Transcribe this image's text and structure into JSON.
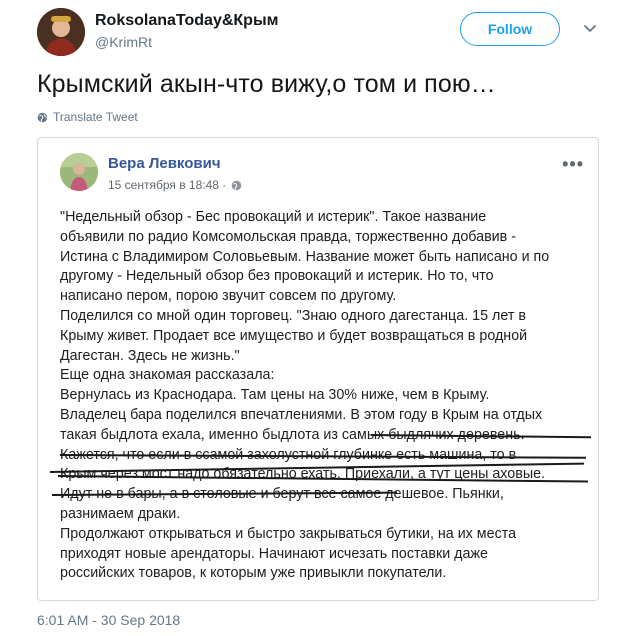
{
  "author": {
    "name": "RoksolanaToday&Крым",
    "handle": "@KrimRt"
  },
  "follow_label": "Follow",
  "tweet_text": "Крымский акын-что вижу,о том и пою…",
  "translate_label": "Translate Tweet",
  "embedded_post": {
    "author_name": "Вера Левкович",
    "date": "15 сентября в 18:48 ·",
    "more_label": "•••",
    "lines": [
      "\"Недельный обзор - Бес провокаций и истерик\". Такое название",
      "объявили по радио Комсомольская правда, торжественно добавив -",
      "Истина с Владимиром Соловьевым. Название может быть написано и по",
      "другому - Недельный обзор без провокаций и истерик. Но то, что",
      "написано пером, порою звучит совсем по другому.",
      "Поделился со мной один торговец. \"Знаю одного дагестанца. 15 лет в",
      "Крыму живет. Продает все имущество и будет возвращаться в родной",
      "Дагестан. Здесь не жизнь.\"",
      "Еще одна знакомая рассказала:",
      "Вернулась из Краснодара. Там цены на 30% ниже, чем в Крыму.",
      "Владелец бара поделился впечатлениями. В этом году в Крым на отдых",
      "такая быдлота ехала, именно быдлота из самых быдлячих деревень.",
      "Кажется, что если в ссамой захолустной глубинке есть машина, то в",
      "Крым через мост надо обязательно ехать. Приехали, а тут цены аховые.",
      "Идут не в бары, а в столовые и берут все самое дешевое. Пьянки,",
      "разнимаем драки.",
      "Продолжают открываться и быстро закрываться бутики, на их места",
      "приходят новые арендаторы. Начинают исчезать поставки даже",
      "российских товаров, к которым уже привыкли покупатели."
    ]
  },
  "timestamp": "6:01 AM - 30 Sep 2018",
  "icons": {
    "globe": "globe-icon",
    "chevron": "chevron-down-icon",
    "public": "public-globe-icon"
  },
  "colors": {
    "accent": "#1da1f2",
    "fb_link": "#365899",
    "muted": "#657786"
  }
}
